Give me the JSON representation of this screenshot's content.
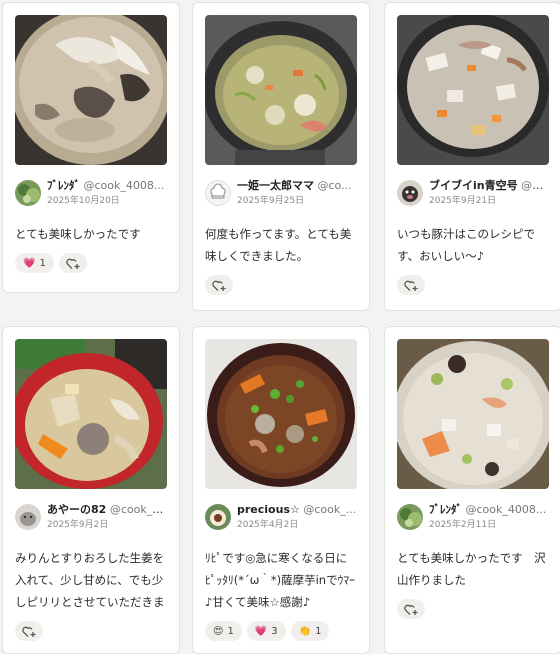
{
  "cards": [
    {
      "author_name": "ﾌﾞﾚﾝﾀﾞ",
      "author_handle": "@cook_4008...",
      "date": "2025年10月20日",
      "comment": "とても美味しかったです",
      "reactions": [
        {
          "icon": "heart-icon",
          "emoji": "💗",
          "count": "1"
        }
      ],
      "avatar_icon": "plant-avatar-icon",
      "photo": "miso-soup-photo"
    },
    {
      "author_name": "一姫一太郎ママ",
      "author_handle": "@co...",
      "date": "2025年9月25日",
      "comment": "何度も作ってます。とても美味しくできました。",
      "reactions": [],
      "avatar_icon": "chef-hat-avatar-icon",
      "photo": "pork-soup-pot-photo"
    },
    {
      "author_name": "ブイブイin青空号",
      "author_handle": "@co...",
      "date": "2025年9月21日",
      "comment": "いつも豚汁はこのレシピです、おいしい〜♪",
      "reactions": [],
      "avatar_icon": "dog-avatar-icon",
      "photo": "pork-veg-pot-photo"
    },
    {
      "author_name": "あやーの82",
      "author_handle": "@cook_40...",
      "date": "2025年9月2日",
      "comment": "みりんとすりおろした生姜を入れて、少し甘めに、でも少しピリリとさせていただきました！...",
      "reactions": [],
      "avatar_icon": "pet-avatar-icon",
      "photo": "red-bowl-soup-photo"
    },
    {
      "author_name": "precious☆",
      "author_handle": "@cook_...",
      "date": "2025年4月2日",
      "comment": "ﾘﾋﾟです◎急に寒くなる日にﾋﾟｯﾀﾘ(*´ω｀*)薩摩芋inでｳﾏｰ♪甘くて美味☆感謝♪",
      "reactions": [
        {
          "icon": "smile-icon",
          "emoji": "😍",
          "count": "1"
        },
        {
          "icon": "heart-icon",
          "emoji": "💗",
          "count": "3"
        },
        {
          "icon": "clap-icon",
          "emoji": "👏",
          "count": "1"
        }
      ],
      "avatar_icon": "food-avatar-icon",
      "photo": "dark-bowl-soup-photo"
    },
    {
      "author_name": "ﾌﾞﾚﾝﾀﾞ",
      "author_handle": "@cook_4008...",
      "date": "2025年2月11日",
      "comment": "とても美味しかったです　沢山作りました",
      "reactions": [],
      "avatar_icon": "plant-avatar-icon",
      "photo": "light-soup-photo"
    }
  ],
  "colors": {
    "heart": "#e0315f",
    "pill_bg": "#f0efec"
  }
}
